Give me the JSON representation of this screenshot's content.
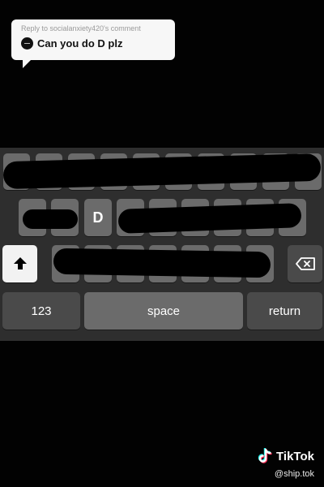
{
  "reply": {
    "header": "Reply to socialanxiety420's comment",
    "text": "Can you do D plz"
  },
  "keyboard": {
    "visible_letter": "D",
    "numbers_label": "123",
    "space_label": "space",
    "return_label": "return",
    "shift_icon": "shift-arrow-icon",
    "delete_icon": "backspace-icon"
  },
  "watermark": {
    "brand": "TikTok",
    "handle": "@ship.tok"
  }
}
